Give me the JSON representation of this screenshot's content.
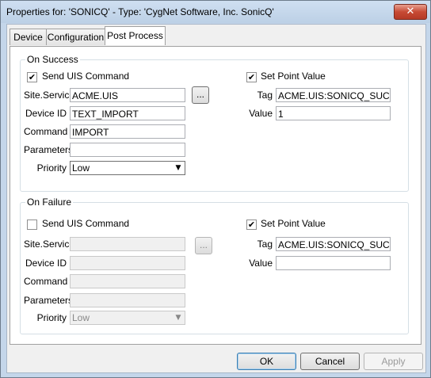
{
  "window": {
    "title": "Properties for: 'SONICQ' - Type: 'CygNet Software, Inc. SonicQ'",
    "close_label": "✕"
  },
  "tabs": [
    {
      "label": "Device"
    },
    {
      "label": "Configuration"
    },
    {
      "label": "Post Process"
    }
  ],
  "active_tab": "Post Process",
  "on_success": {
    "legend": "On Success",
    "send_uis_label": "Send UIS Command",
    "send_uis_checked": true,
    "site_service_label": "Site.Service",
    "site_service_value": "ACME.UIS",
    "browse_label": "...",
    "device_id_label": "Device ID",
    "device_id_value": "TEXT_IMPORT",
    "command_label": "Command",
    "command_value": "IMPORT",
    "parameters_label": "Parameters",
    "parameters_value": "",
    "priority_label": "Priority",
    "priority_value": "Low",
    "set_point_label": "Set Point Value",
    "set_point_checked": true,
    "tag_label": "Tag",
    "tag_value": "ACME.UIS:SONICQ_SUCCES",
    "value_label": "Value",
    "value_value": "1"
  },
  "on_failure": {
    "legend": "On Failure",
    "send_uis_label": "Send UIS Command",
    "send_uis_checked": false,
    "site_service_label": "Site.Service",
    "site_service_value": "",
    "browse_label": "...",
    "device_id_label": "Device ID",
    "device_id_value": "",
    "command_label": "Command",
    "command_value": "",
    "parameters_label": "Parameters",
    "parameters_value": "",
    "priority_label": "Priority",
    "priority_value": "Low",
    "set_point_label": "Set Point Value",
    "set_point_checked": true,
    "tag_label": "Tag",
    "tag_value": "ACME.UIS:SONICQ_SUCCES",
    "value_label": "Value",
    "value_value": ""
  },
  "buttons": {
    "ok": "OK",
    "cancel": "Cancel",
    "apply": "Apply"
  },
  "check_glyph": "✔",
  "dropdown_glyph": "▼"
}
